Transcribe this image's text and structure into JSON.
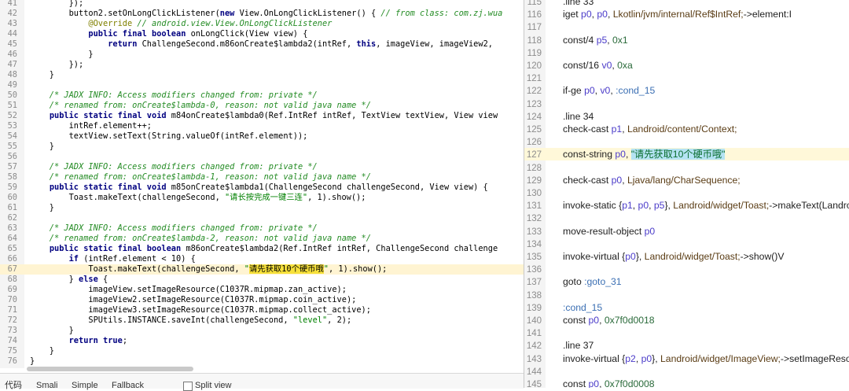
{
  "java_lines": [
    {
      "n": "41",
      "segs": [
        [
          "",
          "        });"
        ]
      ]
    },
    {
      "n": "42",
      "segs": [
        [
          "",
          "        button2.setOnLongClickListener("
        ],
        [
          "kw",
          "new"
        ],
        [
          "",
          " View.OnLongClickListener() { "
        ],
        [
          "cm",
          "// from class: com.zj.wua"
        ]
      ]
    },
    {
      "n": "43",
      "segs": [
        [
          "",
          "            "
        ],
        [
          "an",
          "@Override"
        ],
        [
          "cm",
          " // android.view.View.OnLongClickListener"
        ]
      ]
    },
    {
      "n": "44",
      "segs": [
        [
          "",
          "            "
        ],
        [
          "kw",
          "public final boolean"
        ],
        [
          "",
          " onLongClick(View view) {"
        ]
      ]
    },
    {
      "n": "45",
      "segs": [
        [
          "",
          "                "
        ],
        [
          "kw",
          "return"
        ],
        [
          "",
          " ChallengeSecond.m86onCreate$lambda2(intRef, "
        ],
        [
          "kw",
          "this"
        ],
        [
          "",
          ", imageView, imageView2,"
        ]
      ]
    },
    {
      "n": "46",
      "segs": [
        [
          "",
          "            }"
        ]
      ]
    },
    {
      "n": "47",
      "segs": [
        [
          "",
          "        });"
        ]
      ]
    },
    {
      "n": "48",
      "segs": [
        [
          "",
          "    }"
        ]
      ]
    },
    {
      "n": "49",
      "segs": []
    },
    {
      "n": "50",
      "segs": [
        [
          "cm",
          "    /* JADX INFO: Access modifiers changed from: private */"
        ]
      ]
    },
    {
      "n": "51",
      "segs": [
        [
          "cm",
          "    /* renamed from: onCreate$lambda-0, reason: not valid java name */"
        ]
      ]
    },
    {
      "n": "52",
      "segs": [
        [
          "",
          "    "
        ],
        [
          "kw",
          "public static final void"
        ],
        [
          "",
          " m84onCreate$lambda0(Ref.IntRef intRef, TextView textView, View view"
        ]
      ]
    },
    {
      "n": "53",
      "segs": [
        [
          "",
          "        intRef.element++;"
        ]
      ]
    },
    {
      "n": "54",
      "segs": [
        [
          "",
          "        textView.setText(String.valueOf(intRef.element));"
        ]
      ]
    },
    {
      "n": "55",
      "segs": [
        [
          "",
          "    }"
        ]
      ]
    },
    {
      "n": "56",
      "segs": []
    },
    {
      "n": "57",
      "segs": [
        [
          "cm",
          "    /* JADX INFO: Access modifiers changed from: private */"
        ]
      ]
    },
    {
      "n": "58",
      "segs": [
        [
          "cm",
          "    /* renamed from: onCreate$lambda-1, reason: not valid java name */"
        ]
      ]
    },
    {
      "n": "59",
      "segs": [
        [
          "",
          "    "
        ],
        [
          "kw",
          "public static final void"
        ],
        [
          "",
          " m85onCreate$lambda1(ChallengeSecond challengeSecond, View view) {"
        ]
      ]
    },
    {
      "n": "60",
      "segs": [
        [
          "",
          "        Toast.makeText(challengeSecond, "
        ],
        [
          "st",
          "\"请长按完成一键三连\""
        ],
        [
          "",
          ", 1).show();"
        ]
      ]
    },
    {
      "n": "61",
      "segs": [
        [
          "",
          "    }"
        ]
      ]
    },
    {
      "n": "62",
      "segs": []
    },
    {
      "n": "63",
      "segs": [
        [
          "cm",
          "    /* JADX INFO: Access modifiers changed from: private */"
        ]
      ]
    },
    {
      "n": "64",
      "segs": [
        [
          "cm",
          "    /* renamed from: onCreate$lambda-2, reason: not valid java name */"
        ]
      ]
    },
    {
      "n": "65",
      "segs": [
        [
          "",
          "    "
        ],
        [
          "kw",
          "public static final boolean"
        ],
        [
          "",
          " m86onCreate$lambda2(Ref.IntRef intRef, ChallengeSecond challenge"
        ]
      ]
    },
    {
      "n": "66",
      "segs": [
        [
          "",
          "        "
        ],
        [
          "kw",
          "if"
        ],
        [
          "",
          " (intRef.element < 10) {"
        ]
      ]
    },
    {
      "n": "67",
      "cur": true,
      "segs": [
        [
          "",
          "            Toast.makeText(challengeSecond, "
        ],
        [
          "st",
          "\""
        ],
        [
          "hl",
          "请先获取10个硬币哦"
        ],
        [
          "st",
          "\""
        ],
        [
          "",
          ", 1).show();"
        ]
      ]
    },
    {
      "n": "68",
      "segs": [
        [
          "",
          "        } "
        ],
        [
          "kw",
          "else"
        ],
        [
          "",
          " {"
        ]
      ]
    },
    {
      "n": "69",
      "segs": [
        [
          "",
          "            imageView.setImageResource(C1037R.mipmap.zan_active);"
        ]
      ]
    },
    {
      "n": "70",
      "segs": [
        [
          "",
          "            imageView2.setImageResource(C1037R.mipmap.coin_active);"
        ]
      ]
    },
    {
      "n": "71",
      "segs": [
        [
          "",
          "            imageView3.setImageResource(C1037R.mipmap.collect_active);"
        ]
      ]
    },
    {
      "n": "72",
      "segs": [
        [
          "",
          "            SPUtils.INSTANCE.saveInt(challengeSecond, "
        ],
        [
          "st",
          "\"level\""
        ],
        [
          "",
          ", 2);"
        ]
      ]
    },
    {
      "n": "73",
      "segs": [
        [
          "",
          "        }"
        ]
      ]
    },
    {
      "n": "74",
      "segs": [
        [
          "",
          "        "
        ],
        [
          "kw",
          "return true"
        ],
        [
          "",
          ";"
        ]
      ]
    },
    {
      "n": "75",
      "segs": [
        [
          "",
          "    }"
        ]
      ]
    },
    {
      "n": "76",
      "segs": [
        [
          "",
          "}"
        ]
      ]
    }
  ],
  "smali_lines": [
    {
      "n": "115",
      "segs": [
        [
          "",
          ".line 33"
        ]
      ]
    },
    {
      "n": "116",
      "segs": [
        [
          "",
          "iget "
        ],
        [
          "reg",
          "p0"
        ],
        [
          "",
          ", "
        ],
        [
          "reg",
          "p0"
        ],
        [
          "",
          ", "
        ],
        [
          "typ",
          "Lkotlin/jvm/internal/Ref$IntRef;"
        ],
        [
          "",
          "->element:I"
        ]
      ]
    },
    {
      "n": "117",
      "segs": []
    },
    {
      "n": "118",
      "segs": [
        [
          "",
          "const/4 "
        ],
        [
          "reg",
          "p5"
        ],
        [
          "",
          ", "
        ],
        [
          "lit",
          "0x1"
        ]
      ]
    },
    {
      "n": "119",
      "segs": []
    },
    {
      "n": "120",
      "segs": [
        [
          "",
          "const/16 "
        ],
        [
          "reg",
          "v0"
        ],
        [
          "",
          ", "
        ],
        [
          "lit",
          "0xa"
        ]
      ]
    },
    {
      "n": "121",
      "segs": []
    },
    {
      "n": "122",
      "segs": [
        [
          "",
          "if-ge "
        ],
        [
          "reg",
          "p0"
        ],
        [
          "",
          ", "
        ],
        [
          "reg",
          "v0"
        ],
        [
          "",
          ", "
        ],
        [
          "lbl",
          ":cond_15"
        ]
      ]
    },
    {
      "n": "123",
      "segs": []
    },
    {
      "n": "124",
      "segs": [
        [
          "",
          ".line 34"
        ]
      ]
    },
    {
      "n": "125",
      "segs": [
        [
          "",
          "check-cast "
        ],
        [
          "reg",
          "p1"
        ],
        [
          "",
          ", "
        ],
        [
          "typ",
          "Landroid/content/Context;"
        ]
      ]
    },
    {
      "n": "126",
      "segs": []
    },
    {
      "n": "127",
      "cur": true,
      "segs": [
        [
          "",
          "const-string "
        ],
        [
          "reg",
          "p0"
        ],
        [
          "",
          ", "
        ],
        [
          "sstr",
          "\"请先获取10个硬币哦\""
        ]
      ]
    },
    {
      "n": "128",
      "segs": []
    },
    {
      "n": "129",
      "segs": [
        [
          "",
          "check-cast "
        ],
        [
          "reg",
          "p0"
        ],
        [
          "",
          ", "
        ],
        [
          "typ",
          "Ljava/lang/CharSequence;"
        ]
      ]
    },
    {
      "n": "130",
      "segs": []
    },
    {
      "n": "131",
      "segs": [
        [
          "",
          "invoke-static {"
        ],
        [
          "reg",
          "p1"
        ],
        [
          "",
          ", "
        ],
        [
          "reg",
          "p0"
        ],
        [
          "",
          ", "
        ],
        [
          "reg",
          "p5"
        ],
        [
          "",
          "}, "
        ],
        [
          "typ",
          "Landroid/widget/Toast;"
        ],
        [
          "",
          "->makeText(Landro"
        ]
      ]
    },
    {
      "n": "132",
      "segs": []
    },
    {
      "n": "133",
      "segs": [
        [
          "",
          "move-result-object "
        ],
        [
          "reg",
          "p0"
        ]
      ]
    },
    {
      "n": "134",
      "segs": []
    },
    {
      "n": "135",
      "segs": [
        [
          "",
          "invoke-virtual {"
        ],
        [
          "reg",
          "p0"
        ],
        [
          "",
          "}, "
        ],
        [
          "typ",
          "Landroid/widget/Toast;"
        ],
        [
          "",
          "->show()V"
        ]
      ]
    },
    {
      "n": "136",
      "segs": []
    },
    {
      "n": "137",
      "segs": [
        [
          "",
          "goto "
        ],
        [
          "lbl",
          ":goto_31"
        ]
      ]
    },
    {
      "n": "138",
      "segs": []
    },
    {
      "n": "139",
      "segs": [
        [
          "lbl",
          ":cond_15"
        ]
      ]
    },
    {
      "n": "140",
      "segs": [
        [
          "",
          "const "
        ],
        [
          "reg",
          "p0"
        ],
        [
          "",
          ", "
        ],
        [
          "lit",
          "0x7f0d0018"
        ]
      ]
    },
    {
      "n": "141",
      "segs": []
    },
    {
      "n": "142",
      "segs": [
        [
          "",
          ".line 37"
        ]
      ]
    },
    {
      "n": "143",
      "segs": [
        [
          "",
          "invoke-virtual {"
        ],
        [
          "reg",
          "p2"
        ],
        [
          "",
          ", "
        ],
        [
          "reg",
          "p0"
        ],
        [
          "",
          "}, "
        ],
        [
          "typ",
          "Landroid/widget/ImageView;"
        ],
        [
          "",
          "->setImageReso"
        ]
      ]
    },
    {
      "n": "144",
      "segs": []
    },
    {
      "n": "145",
      "segs": [
        [
          "",
          "const "
        ],
        [
          "reg",
          "p0"
        ],
        [
          "",
          ", "
        ],
        [
          "lit",
          "0x7f0d0008"
        ]
      ]
    }
  ],
  "tabs": {
    "code": "代码",
    "smali": "Smali",
    "simple": "Simple",
    "fallback": "Fallback",
    "split_view": "Split view"
  },
  "colors": {
    "string_highlight": "#f7e13b",
    "smali_string_highlight": "#b5e3f3",
    "current_line": "#fff4d2"
  }
}
